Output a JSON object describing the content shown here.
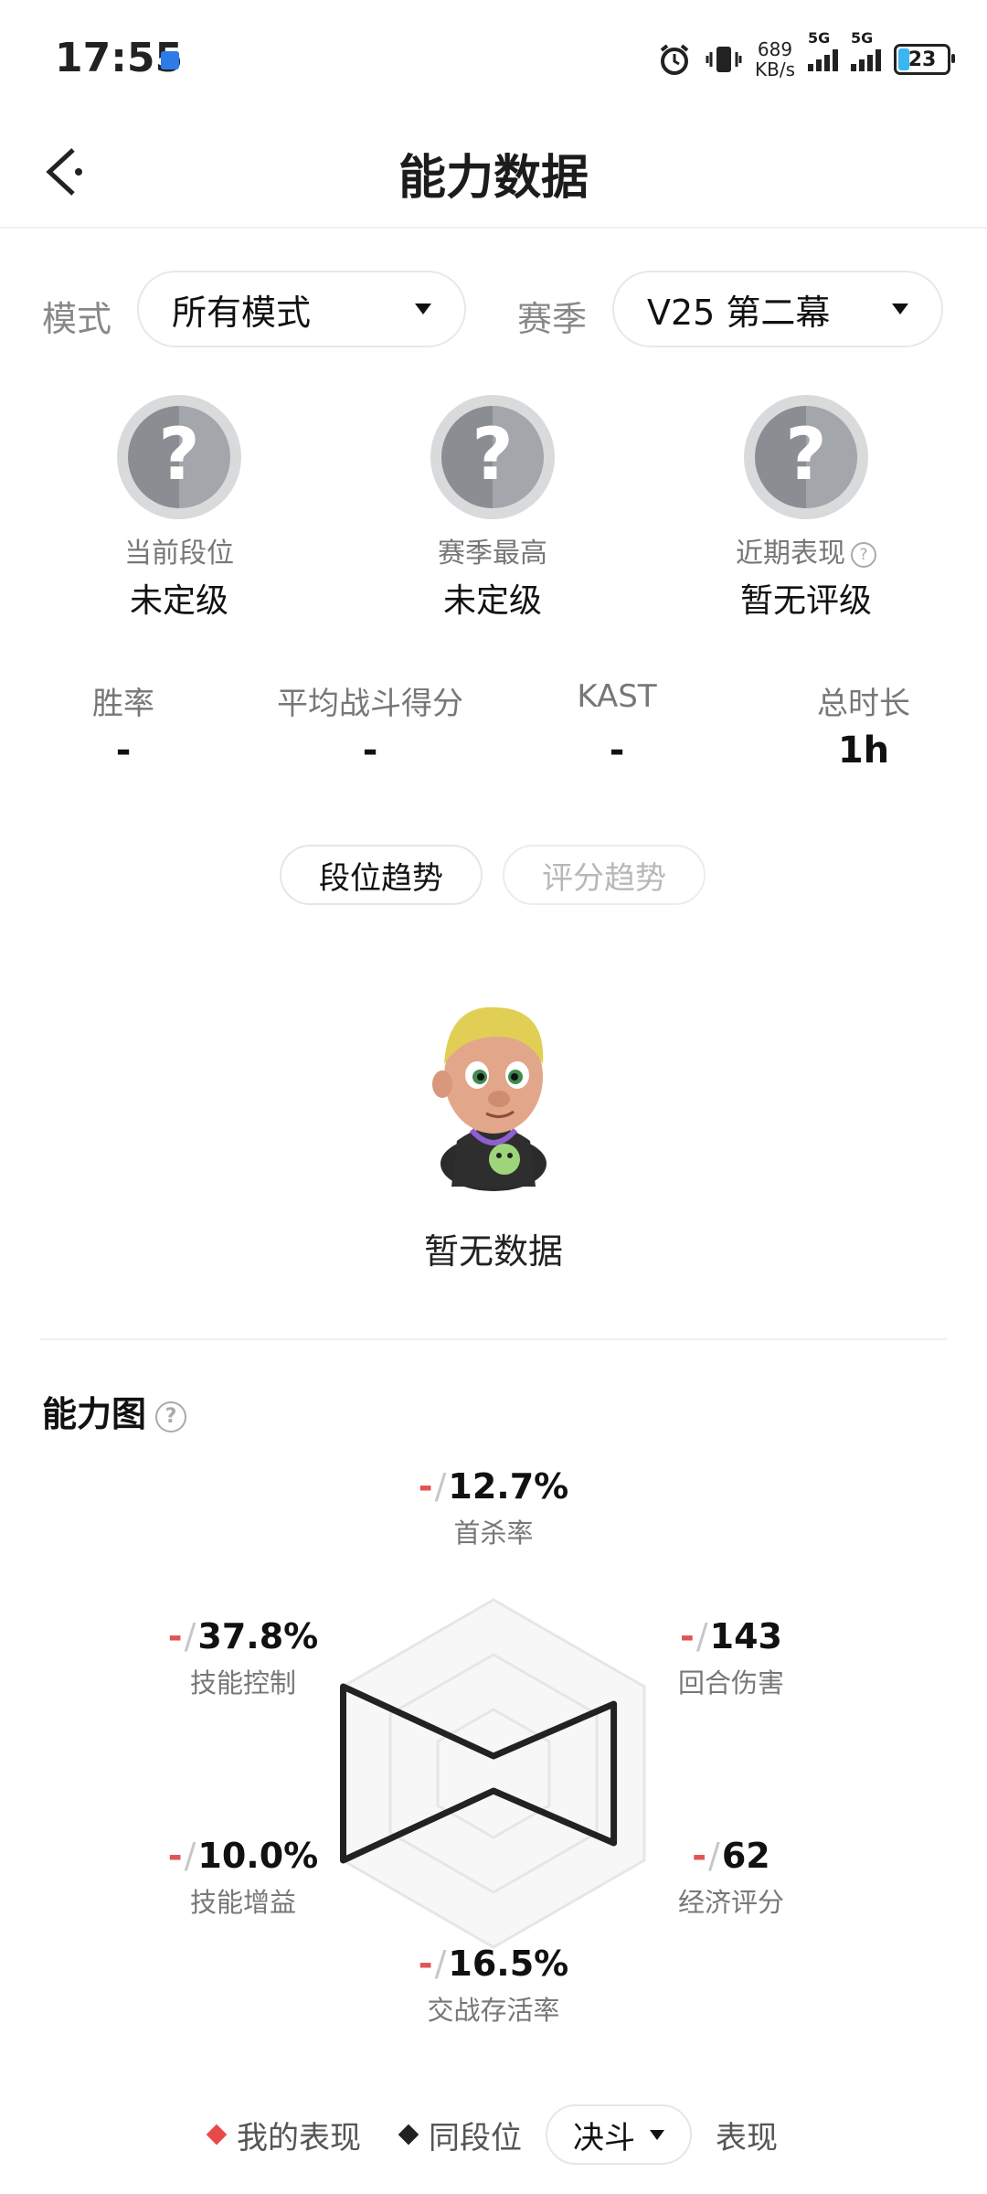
{
  "status_bar": {
    "time": "17:55",
    "net_speed_value": "689",
    "net_speed_unit": "KB/s",
    "signal1": "5G",
    "signal2": "5G",
    "battery": "23"
  },
  "header": {
    "title": "能力数据",
    "back_icon": "back-arrow-icon"
  },
  "filters": {
    "mode_label": "模式",
    "mode_value": "所有模式",
    "season_label": "赛季",
    "season_value": "V25 第二幕"
  },
  "ranks": [
    {
      "label": "当前段位",
      "value": "未定级"
    },
    {
      "label": "赛季最高",
      "value": "未定级"
    },
    {
      "label": "近期表现",
      "value": "暂无评级"
    }
  ],
  "stats": [
    {
      "label": "胜率",
      "value": "-"
    },
    {
      "label": "平均战斗得分",
      "value": "-"
    },
    {
      "label": "KAST",
      "value": "-"
    },
    {
      "label": "总时长",
      "value": "1h"
    }
  ],
  "trend_tabs": [
    {
      "label": "段位趋势",
      "active": true
    },
    {
      "label": "评分趋势",
      "active": false
    }
  ],
  "empty_state": "暂无数据",
  "ability": {
    "title": "能力图",
    "metrics": {
      "first_kill": {
        "mine": "-",
        "value": "12.7%",
        "label": "首杀率"
      },
      "round_damage": {
        "mine": "-",
        "value": "143",
        "label": "回合伤害"
      },
      "economy": {
        "mine": "-",
        "value": "62",
        "label": "经济评分"
      },
      "survival": {
        "mine": "-",
        "value": "16.5%",
        "label": "交战存活率"
      },
      "skill_buff": {
        "mine": "-",
        "value": "10.0%",
        "label": "技能增益"
      },
      "skill_control": {
        "mine": "-",
        "value": "37.8%",
        "label": "技能控制"
      }
    },
    "peer_relative_levels": {
      "first_kill": 0.1,
      "round_damage": 0.8,
      "economy": 0.8,
      "survival": 0.1,
      "skill_buff": 1.0,
      "skill_control": 1.0
    }
  },
  "legend": {
    "mine": "我的表现",
    "peer": "同段位",
    "peer_select": "决斗",
    "suffix": "表现",
    "mine_color": "#e84a4a",
    "peer_color": "#222222"
  }
}
